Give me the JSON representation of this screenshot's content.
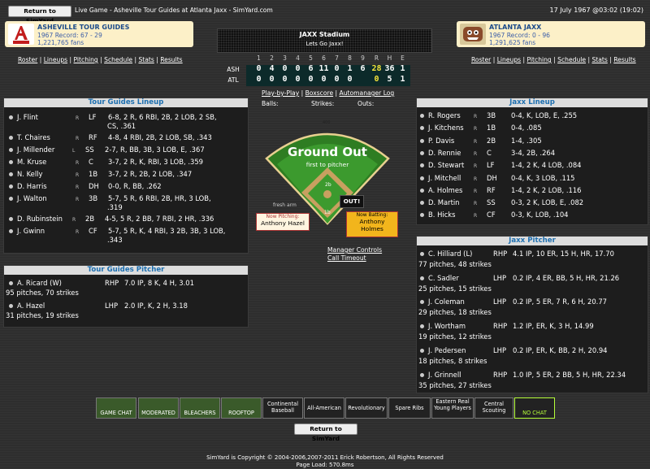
{
  "header": {
    "return_button": "Return to SimYard",
    "title": "Live Game - Asheville Tour Guides at Atlanta Jaxx - SimYard.com",
    "date": "17 July 1967 @03:02 (19:02)"
  },
  "away_team": {
    "name": "ASHEVILLE TOUR GUIDES",
    "record": "1967 Record: 67 - 29",
    "fans": "1,221,765 fans",
    "logo_text": "TOUR GUIDES",
    "links": [
      "Roster",
      "Lineups",
      "Pitching",
      "Schedule",
      "Stats",
      "Results"
    ]
  },
  "home_team": {
    "name": "ATLANTA JAXX",
    "record": "1967 Record: 0 - 96",
    "fans": "1,291,625 fans",
    "links": [
      "Roster",
      "Lineups",
      "Pitching",
      "Schedule",
      "Stats",
      "Results"
    ]
  },
  "scoreboard": {
    "stadium": "JAXX Stadium",
    "slogan": "Lets Go Jaxx!",
    "columns": [
      "1",
      "2",
      "3",
      "4",
      "5",
      "6",
      "7",
      "8",
      "9",
      "R",
      "H",
      "E"
    ],
    "away_abbr": "ASH",
    "home_abbr": "ATL",
    "away_line": [
      "0",
      "4",
      "0",
      "0",
      "6",
      "11",
      "0",
      "1",
      "6",
      "28",
      "36",
      "1"
    ],
    "home_line": [
      "0",
      "0",
      "0",
      "0",
      "0",
      "0",
      "0",
      "0",
      "",
      "0",
      "5",
      "1"
    ],
    "colors": {
      "digit": "#ffffff",
      "runs": "#f5e23a",
      "panel": "#0c2a2a"
    }
  },
  "game_links": [
    "Play-by-Play",
    "Boxscore",
    "Automanager Log"
  ],
  "count": {
    "balls_label": "Balls:",
    "strikes_label": "Strikes:",
    "outs_label": "Outs:"
  },
  "field": {
    "result": "Ground Out",
    "detail": "first to pitcher",
    "distance": "400",
    "fresh_arm": "fresh arm",
    "outs_badge": "OUT!",
    "bases": {
      "second": "2b",
      "first": "1b"
    },
    "now_pitching_label": "Now Pitching:",
    "now_pitching": "Anthony Hazel",
    "now_batting_label": "Now Batting:",
    "now_batting": "Anthony Holmes",
    "manager_controls": "Manager Controls",
    "call_timeout": "Call Timeout"
  },
  "away_lineup": {
    "title": "Tour Guides Lineup",
    "players": [
      {
        "name": "J. Flint",
        "hand": "R",
        "pos": "LF",
        "line1": "6-8, 2 R, 6 RBI, 2B, 2 LOB, 2 SB,",
        "line2": "CS, .361"
      },
      {
        "name": "T. Chaires",
        "hand": "R",
        "pos": "RF",
        "line1": "4-8, 4 RBI, 2B, 2 LOB, SB, .343",
        "line2": ""
      },
      {
        "name": "J. Millender",
        "hand": "L",
        "pos": "SS",
        "line1": "2-7, R, BB, 3B, 3 LOB, E, .367",
        "line2": ""
      },
      {
        "name": "M. Kruse",
        "hand": "R",
        "pos": "C",
        "line1": "3-7, 2 R, K, RBI, 3 LOB, .359",
        "line2": ""
      },
      {
        "name": "N. Kelly",
        "hand": "R",
        "pos": "1B",
        "line1": "3-7, 2 R, 2B, 2 LOB, .347",
        "line2": ""
      },
      {
        "name": "D. Harris",
        "hand": "R",
        "pos": "DH",
        "line1": "0-0, R, BB, .262",
        "line2": ""
      },
      {
        "name": "J. Walton",
        "hand": "R",
        "pos": "3B",
        "line1": "5-7, 5 R, 6 RBI, 2B, HR, 3 LOB,",
        "line2": ".319"
      },
      {
        "name": "D. Rubinstein",
        "hand": "R",
        "pos": "2B",
        "line1": "4-5, 5 R, 2 BB, 7 RBI, 2 HR, .336",
        "line2": ""
      },
      {
        "name": "J. Gwinn",
        "hand": "R",
        "pos": "CF",
        "line1": "5-7, 5 R, K, 4 RBI, 3 2B, 3B, 3 LOB,",
        "line2": ".343"
      }
    ]
  },
  "away_pitchers": {
    "title": "Tour Guides Pitcher",
    "pitchers": [
      {
        "name": "A. Ricard (W)",
        "throws": "RHP",
        "line": "7.0 IP, 8 K, 4 H, 3.01",
        "pitches": "95 pitches, 70 strikes"
      },
      {
        "name": "A. Hazel",
        "throws": "LHP",
        "line": "2.0 IP, K, 2 H, 3.18",
        "pitches": "31 pitches, 19 strikes"
      }
    ]
  },
  "home_lineup": {
    "title": "Jaxx Lineup",
    "players": [
      {
        "name": "R. Rogers",
        "hand": "R",
        "pos": "3B",
        "line": "0-4, K, LOB, E, .255"
      },
      {
        "name": "J. Kitchens",
        "hand": "R",
        "pos": "1B",
        "line": "0-4, .085"
      },
      {
        "name": "P. Davis",
        "hand": "R",
        "pos": "2B",
        "line": "1-4, .305"
      },
      {
        "name": "D. Rennie",
        "hand": "R",
        "pos": "C",
        "line": "3-4, 2B, .264"
      },
      {
        "name": "D. Stewart",
        "hand": "R",
        "pos": "LF",
        "line": "1-4, 2 K, 4 LOB, .084"
      },
      {
        "name": "J. Mitchell",
        "hand": "R",
        "pos": "DH",
        "line": "0-4, K, 3 LOB, .115"
      },
      {
        "name": "A. Holmes",
        "hand": "R",
        "pos": "RF",
        "line": "1-4, 2 K, 2 LOB, .116"
      },
      {
        "name": "D. Martin",
        "hand": "R",
        "pos": "SS",
        "line": "0-3, 2 K, LOB, E, .082"
      },
      {
        "name": "B. Hicks",
        "hand": "R",
        "pos": "CF",
        "line": "0-3, K, LOB, .104"
      }
    ]
  },
  "home_pitchers": {
    "title": "Jaxx Pitcher",
    "pitchers": [
      {
        "name": "C. Hilliard (L)",
        "throws": "RHP",
        "line": "4.1 IP, 10 ER, 15 H, HR, 17.70",
        "pitches": "77 pitches, 48 strikes"
      },
      {
        "name": "C. Sadler",
        "throws": "LHP",
        "line": "0.2 IP, 4 ER, BB, 5 H, HR, 21.26",
        "pitches": "25 pitches, 15 strikes"
      },
      {
        "name": "J. Coleman",
        "throws": "LHP",
        "line": "0.2 IP, 5 ER, 7 R, 6 H, 20.77",
        "pitches": "29 pitches, 18 strikes"
      },
      {
        "name": "J. Wortham",
        "throws": "RHP",
        "line": "1.2 IP, ER, K, 3 H, 14.99",
        "pitches": "19 pitches, 12 strikes"
      },
      {
        "name": "J. Pedersen",
        "throws": "LHP",
        "line": "0.2 IP, ER, K, BB, 2 H, 20.94",
        "pitches": "18 pitches, 8 strikes"
      },
      {
        "name": "J. Grinnell",
        "throws": "RHP",
        "line": "1.0 IP, 5 ER, 2 BB, 5 H, HR, 22.34",
        "pitches": "35 pitches, 27 strikes"
      }
    ]
  },
  "chat_buttons": [
    "GAME CHAT",
    "MODERATED",
    "BLEACHERS",
    "ROOFTOP",
    "Continental Baseball",
    "All-American",
    "Revolutionary",
    "Spare Ribs",
    "Eastern Real Young Players",
    "Central Scouting",
    "NO CHAT"
  ],
  "bottom_return": "Return to SimYard",
  "footer": {
    "copyright": "SimYard is Copyright © 2004-2006,2007-2011 Erick Robertson, All Rights Reserved",
    "page_load": "Page Load: 570.8ms"
  }
}
